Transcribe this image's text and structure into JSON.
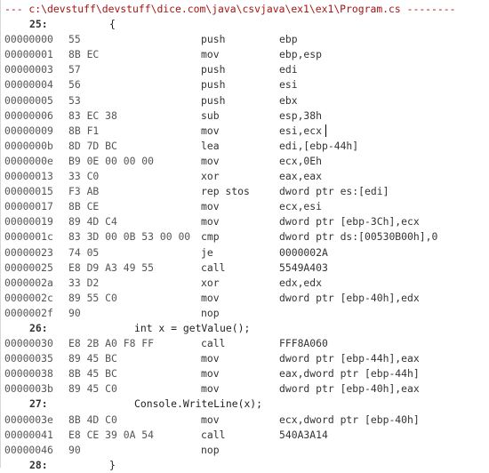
{
  "header": {
    "text": "--- c:\\devstuff\\devstuff\\dice.com\\java\\csvjava\\ex1\\ex1\\Program.cs --------"
  },
  "colors": {
    "header": "#a31515",
    "text": "#1e1e1e"
  },
  "lines": [
    {
      "type": "source",
      "lineno": "25:",
      "code": "{",
      "indent": 1
    },
    {
      "type": "asm",
      "addr": "00000000",
      "bytes": "55",
      "mnemonic": "push",
      "operands": "ebp"
    },
    {
      "type": "asm",
      "addr": "00000001",
      "bytes": "8B EC",
      "mnemonic": "mov",
      "operands": "ebp,esp"
    },
    {
      "type": "asm",
      "addr": "00000003",
      "bytes": "57",
      "mnemonic": "push",
      "operands": "edi"
    },
    {
      "type": "asm",
      "addr": "00000004",
      "bytes": "56",
      "mnemonic": "push",
      "operands": "esi"
    },
    {
      "type": "asm",
      "addr": "00000005",
      "bytes": "53",
      "mnemonic": "push",
      "operands": "ebx"
    },
    {
      "type": "asm",
      "addr": "00000006",
      "bytes": "83 EC 38",
      "mnemonic": "sub",
      "operands": "esp,38h"
    },
    {
      "type": "asm",
      "addr": "00000009",
      "bytes": "8B F1",
      "mnemonic": "mov",
      "operands": "esi,ecx",
      "caret": true
    },
    {
      "type": "asm",
      "addr": "0000000b",
      "bytes": "8D 7D BC",
      "mnemonic": "lea",
      "operands": "edi,[ebp-44h]"
    },
    {
      "type": "asm",
      "addr": "0000000e",
      "bytes": "B9 0E 00 00 00",
      "mnemonic": "mov",
      "operands": "ecx,0Eh"
    },
    {
      "type": "asm",
      "addr": "00000013",
      "bytes": "33 C0",
      "mnemonic": "xor",
      "operands": "eax,eax"
    },
    {
      "type": "asm",
      "addr": "00000015",
      "bytes": "F3 AB",
      "mnemonic": "rep stos",
      "operands": "dword ptr es:[edi]"
    },
    {
      "type": "asm",
      "addr": "00000017",
      "bytes": "8B CE",
      "mnemonic": "mov",
      "operands": "ecx,esi"
    },
    {
      "type": "asm",
      "addr": "00000019",
      "bytes": "89 4D C4",
      "mnemonic": "mov",
      "operands": "dword ptr [ebp-3Ch],ecx"
    },
    {
      "type": "asm",
      "addr": "0000001c",
      "bytes": "83 3D 00 0B 53 00 00",
      "mnemonic": "cmp",
      "operands": "dword ptr ds:[00530B00h],0"
    },
    {
      "type": "asm",
      "addr": "00000023",
      "bytes": "74 05",
      "mnemonic": "je",
      "operands": "0000002A"
    },
    {
      "type": "asm",
      "addr": "00000025",
      "bytes": "E8 D9 A3 49 55",
      "mnemonic": "call",
      "operands": "5549A403"
    },
    {
      "type": "asm",
      "addr": "0000002a",
      "bytes": "33 D2",
      "mnemonic": "xor",
      "operands": "edx,edx"
    },
    {
      "type": "asm",
      "addr": "0000002c",
      "bytes": "89 55 C0",
      "mnemonic": "mov",
      "operands": "dword ptr [ebp-40h],edx"
    },
    {
      "type": "asm",
      "addr": "0000002f",
      "bytes": "90",
      "mnemonic": "nop",
      "operands": ""
    },
    {
      "type": "source",
      "lineno": "26:",
      "code": "int x = getValue();",
      "indent": 2
    },
    {
      "type": "asm",
      "addr": "00000030",
      "bytes": "E8 2B A0 F8 FF",
      "mnemonic": "call",
      "operands": "FFF8A060"
    },
    {
      "type": "asm",
      "addr": "00000035",
      "bytes": "89 45 BC",
      "mnemonic": "mov",
      "operands": "dword ptr [ebp-44h],eax"
    },
    {
      "type": "asm",
      "addr": "00000038",
      "bytes": "8B 45 BC",
      "mnemonic": "mov",
      "operands": "eax,dword ptr [ebp-44h]"
    },
    {
      "type": "asm",
      "addr": "0000003b",
      "bytes": "89 45 C0",
      "mnemonic": "mov",
      "operands": "dword ptr [ebp-40h],eax"
    },
    {
      "type": "source",
      "lineno": "27:",
      "code": "Console.WriteLine(x);",
      "indent": 2
    },
    {
      "type": "asm",
      "addr": "0000003e",
      "bytes": "8B 4D C0",
      "mnemonic": "mov",
      "operands": "ecx,dword ptr [ebp-40h]"
    },
    {
      "type": "asm",
      "addr": "00000041",
      "bytes": "E8 CE 39 0A 54",
      "mnemonic": "call",
      "operands": "540A3A14"
    },
    {
      "type": "asm",
      "addr": "00000046",
      "bytes": "90",
      "mnemonic": "nop",
      "operands": ""
    },
    {
      "type": "source",
      "lineno": "28:",
      "code": "}",
      "indent": 1
    }
  ]
}
